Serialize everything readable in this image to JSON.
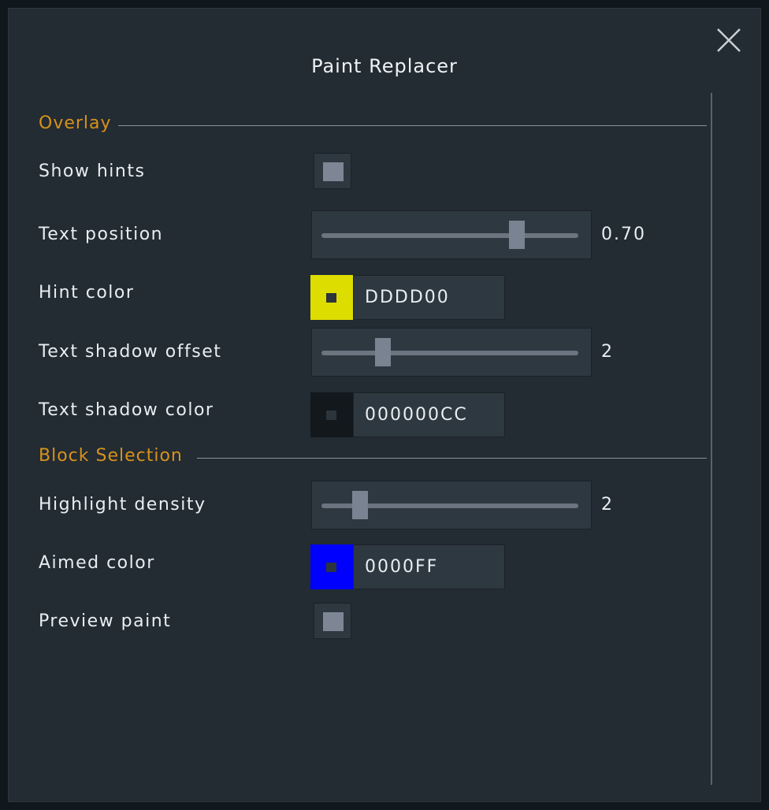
{
  "dialog": {
    "title": "Paint Replacer"
  },
  "sections": {
    "overlay": "Overlay",
    "block_selection": "Block Selection"
  },
  "settings": {
    "show_hints": {
      "label": "Show hints",
      "checked": false
    },
    "text_position": {
      "label": "Text position",
      "value": "0.70",
      "fraction": 0.76
    },
    "hint_color": {
      "label": "Hint color",
      "hex": "DDDD00",
      "swatch": "#dddd00"
    },
    "text_shadow_offset": {
      "label": "Text shadow offset",
      "value": "2",
      "fraction": 0.24
    },
    "text_shadow_color": {
      "label": "Text shadow color",
      "hex": "000000CC",
      "swatch": "#12181c"
    },
    "highlight_density": {
      "label": "Highlight density",
      "value": "2",
      "fraction": 0.15
    },
    "aimed_color": {
      "label": "Aimed color",
      "hex": "0000FF",
      "swatch": "#0000ff"
    },
    "preview_paint": {
      "label": "Preview paint",
      "checked": false
    }
  },
  "colors": {
    "accent": "#d7921b",
    "panel": "#232b33",
    "control": "#2e3840"
  }
}
